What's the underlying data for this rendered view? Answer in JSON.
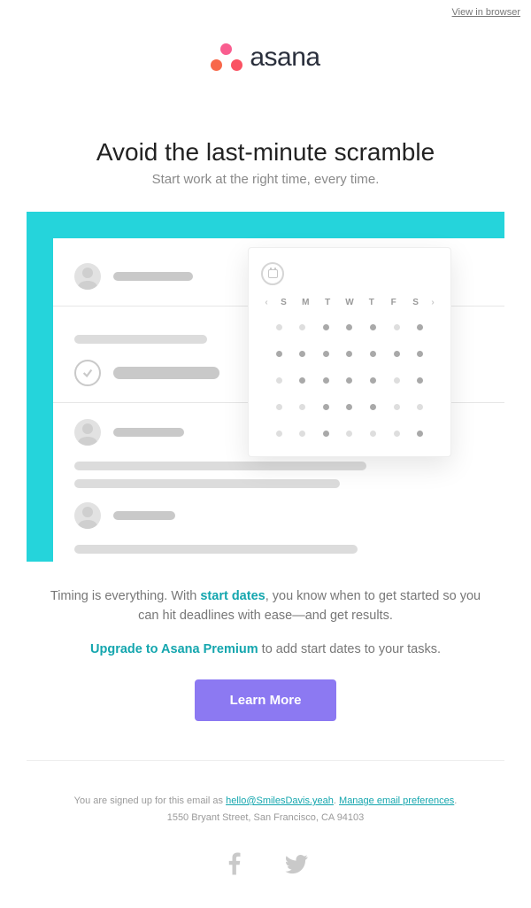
{
  "top": {
    "view_in_browser": "View in browser"
  },
  "brand": {
    "name": "asana"
  },
  "hero": {
    "headline": "Avoid the last-minute scramble",
    "subhead": "Start work at the right time, every time."
  },
  "calendar": {
    "days": [
      "S",
      "M",
      "T",
      "W",
      "T",
      "F",
      "S"
    ],
    "nav_prev": "‹",
    "nav_next": "›",
    "highlighted": [
      3,
      4,
      5,
      7,
      8,
      9,
      10,
      11,
      12,
      13,
      14,
      16,
      17,
      18,
      19,
      21,
      24,
      25,
      26,
      31,
      35
    ]
  },
  "copy": {
    "line1_pre": "Timing is everything. With ",
    "line1_accent": "start dates",
    "line1_post": ", you know when to get started so you can hit deadlines with ease—and get results.",
    "line2_accent": "Upgrade to Asana Premium",
    "line2_post": " to add start dates to your tasks."
  },
  "cta": {
    "label": "Learn More"
  },
  "footer": {
    "signed_up_pre": "You are signed up for this email as ",
    "email": "hello@SmilesDavis.yeah",
    "sep": ". ",
    "manage": "Manage email preferences",
    "end": ".",
    "address": "1550 Bryant Street, San Francisco, CA 94103"
  }
}
